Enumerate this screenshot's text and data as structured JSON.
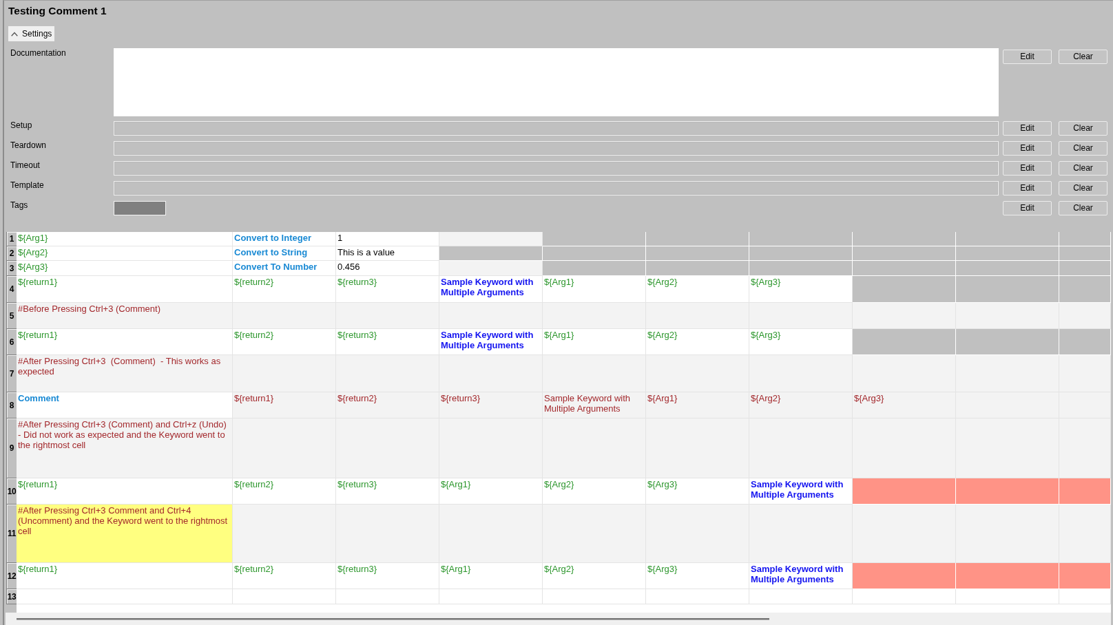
{
  "title": "Testing Comment 1",
  "settings_toggle": {
    "label": "Settings",
    "expanded": true
  },
  "settings": [
    {
      "label": "Documentation",
      "kind": "textarea",
      "buttons": [
        "Edit",
        "Clear"
      ]
    },
    {
      "label": "Setup",
      "kind": "line",
      "buttons": [
        "Edit",
        "Clear"
      ]
    },
    {
      "label": "Teardown",
      "kind": "line",
      "buttons": [
        "Edit",
        "Clear"
      ]
    },
    {
      "label": "Timeout",
      "kind": "line",
      "buttons": [
        "Edit",
        "Clear"
      ]
    },
    {
      "label": "Template",
      "kind": "line",
      "buttons": [
        "Edit",
        "Clear"
      ]
    },
    {
      "label": "Tags",
      "kind": "tags",
      "buttons": [
        "Edit",
        "Clear"
      ]
    }
  ],
  "grid": {
    "rows": [
      {
        "number": "1",
        "cells": [
          {
            "text": "${Arg1}",
            "kind": "variable",
            "color": "#ffffff"
          },
          {
            "text": "Convert to Integer",
            "kind": "library_keyword",
            "color": "#ffffff"
          },
          {
            "text": "1",
            "kind": "value",
            "color": "#ffffff"
          },
          {
            "color": "#f3f3f3"
          },
          {
            "color": "#c0c0c0"
          },
          {
            "color": "#c0c0c0"
          },
          {
            "color": "#c0c0c0"
          },
          {
            "color": "#c0c0c0"
          },
          {
            "color": "#c0c0c0"
          },
          {
            "color": "#c0c0c0"
          }
        ]
      },
      {
        "number": "2",
        "cells": [
          {
            "text": "${Arg2}",
            "kind": "variable",
            "color": "#ffffff"
          },
          {
            "text": "Convert to String",
            "kind": "library_keyword",
            "color": "#ffffff"
          },
          {
            "text": "This is a value",
            "kind": "value",
            "color": "#ffffff"
          },
          {
            "color": "#c0c0c0"
          },
          {
            "color": "#c0c0c0"
          },
          {
            "color": "#c0c0c0"
          },
          {
            "color": "#c0c0c0"
          },
          {
            "color": "#c0c0c0"
          },
          {
            "color": "#c0c0c0"
          },
          {
            "color": "#c0c0c0"
          }
        ]
      },
      {
        "number": "3",
        "cells": [
          {
            "text": "${Arg3}",
            "kind": "variable",
            "color": "#ffffff"
          },
          {
            "text": "Convert To Number",
            "kind": "library_keyword",
            "color": "#ffffff"
          },
          {
            "text": "0.456",
            "kind": "value",
            "color": "#ffffff"
          },
          {
            "color": "#f3f3f3"
          },
          {
            "color": "#c0c0c0"
          },
          {
            "color": "#c0c0c0"
          },
          {
            "color": "#c0c0c0"
          },
          {
            "color": "#c0c0c0"
          },
          {
            "color": "#c0c0c0"
          },
          {
            "color": "#c0c0c0"
          }
        ]
      },
      {
        "number": "4",
        "cells": [
          {
            "text": "${return1}",
            "kind": "variable",
            "color": "#ffffff"
          },
          {
            "text": "${return2}",
            "kind": "variable",
            "color": "#ffffff"
          },
          {
            "text": "${return3}",
            "kind": "variable",
            "color": "#ffffff"
          },
          {
            "text": "Sample Keyword with Multiple Arguments",
            "kind": "user_keyword",
            "color": "#ffffff"
          },
          {
            "text": "${Arg1}",
            "kind": "variable",
            "color": "#ffffff"
          },
          {
            "text": "${Arg2}",
            "kind": "variable",
            "color": "#ffffff"
          },
          {
            "text": "${Arg3}",
            "kind": "variable",
            "color": "#ffffff"
          },
          {
            "color": "#c0c0c0"
          },
          {
            "color": "#c0c0c0"
          },
          {
            "color": "#c0c0c0"
          }
        ]
      },
      {
        "number": "5",
        "cells": [
          {
            "text": "#Before Pressing Ctrl+3 (Comment)",
            "kind": "comment",
            "color": "#f3f3f3"
          },
          {
            "color": "#f3f3f3"
          },
          {
            "color": "#f3f3f3"
          },
          {
            "color": "#f3f3f3"
          },
          {
            "color": "#f3f3f3"
          },
          {
            "color": "#f3f3f3"
          },
          {
            "color": "#f3f3f3"
          },
          {
            "color": "#f3f3f3"
          },
          {
            "color": "#f3f3f3"
          },
          {
            "color": "#f3f3f3"
          }
        ]
      },
      {
        "number": "6",
        "cells": [
          {
            "text": "${return1}",
            "kind": "variable",
            "color": "#ffffff"
          },
          {
            "text": "${return2}",
            "kind": "variable",
            "color": "#ffffff"
          },
          {
            "text": "${return3}",
            "kind": "variable",
            "color": "#ffffff"
          },
          {
            "text": "Sample Keyword with Multiple Arguments",
            "kind": "user_keyword",
            "color": "#ffffff"
          },
          {
            "text": "${Arg1}",
            "kind": "variable",
            "color": "#ffffff"
          },
          {
            "text": "${Arg2}",
            "kind": "variable",
            "color": "#ffffff"
          },
          {
            "text": "${Arg3}",
            "kind": "variable",
            "color": "#ffffff"
          },
          {
            "color": "#c0c0c0"
          },
          {
            "color": "#c0c0c0"
          },
          {
            "color": "#c0c0c0"
          }
        ]
      },
      {
        "number": "7",
        "cells": [
          {
            "text": "#After Pressing Ctrl+3  (Comment)  - This works as expected",
            "kind": "comment",
            "color": "#f3f3f3"
          },
          {
            "color": "#f3f3f3"
          },
          {
            "color": "#f3f3f3"
          },
          {
            "color": "#f3f3f3"
          },
          {
            "color": "#f3f3f3"
          },
          {
            "color": "#f3f3f3"
          },
          {
            "color": "#f3f3f3"
          },
          {
            "color": "#f3f3f3"
          },
          {
            "color": "#f3f3f3"
          },
          {
            "color": "#f3f3f3"
          }
        ]
      },
      {
        "number": "8",
        "cells": [
          {
            "text": "Comment",
            "kind": "library_keyword",
            "color": "#ffffff"
          },
          {
            "text": "${return1}",
            "kind": "comment",
            "color": "#f3f3f3"
          },
          {
            "text": "${return2}",
            "kind": "comment",
            "color": "#f3f3f3"
          },
          {
            "text": "${return3}",
            "kind": "comment",
            "color": "#f3f3f3"
          },
          {
            "text": "Sample Keyword with Multiple Arguments",
            "kind": "comment",
            "color": "#f3f3f3"
          },
          {
            "text": "${Arg1}",
            "kind": "comment",
            "color": "#f3f3f3"
          },
          {
            "text": "${Arg2}",
            "kind": "comment",
            "color": "#f3f3f3"
          },
          {
            "text": "${Arg3}",
            "kind": "comment",
            "color": "#f3f3f3"
          },
          {
            "color": "#f3f3f3"
          },
          {
            "color": "#f3f3f3"
          }
        ]
      },
      {
        "number": "9",
        "cells": [
          {
            "text": "#After Pressing Ctrl+3 (Comment) and Ctrl+z (Undo) - Did not work as expected and the Keyword went to the rightmost cell",
            "kind": "comment",
            "color": "#f3f3f3"
          },
          {
            "color": "#f3f3f3"
          },
          {
            "color": "#f3f3f3"
          },
          {
            "color": "#f3f3f3"
          },
          {
            "color": "#f3f3f3"
          },
          {
            "color": "#f3f3f3"
          },
          {
            "color": "#f3f3f3"
          },
          {
            "color": "#f3f3f3"
          },
          {
            "color": "#f3f3f3"
          },
          {
            "color": "#f3f3f3"
          }
        ]
      },
      {
        "number": "10",
        "cells": [
          {
            "text": "${return1}",
            "kind": "variable",
            "color": "#ffffff"
          },
          {
            "text": "${return2}",
            "kind": "variable",
            "color": "#ffffff"
          },
          {
            "text": "${return3}",
            "kind": "variable",
            "color": "#ffffff"
          },
          {
            "text": "${Arg1}",
            "kind": "variable",
            "color": "#ffffff"
          },
          {
            "text": "${Arg2}",
            "kind": "variable",
            "color": "#ffffff"
          },
          {
            "text": "${Arg3}",
            "kind": "variable",
            "color": "#ffffff"
          },
          {
            "text": "Sample Keyword with Multiple Arguments",
            "kind": "user_keyword",
            "color": "#ffffff"
          },
          {
            "color": "#ff9386"
          },
          {
            "color": "#ff9386"
          },
          {
            "color": "#ff9386"
          }
        ]
      },
      {
        "number": "11",
        "cells": [
          {
            "text": "#After Pressing Ctrl+3 Comment and Ctrl+4 (Uncomment) and the Keyword went to the rightmost cell",
            "kind": "comment",
            "color": "#ffff80"
          },
          {
            "color": "#f3f3f3"
          },
          {
            "color": "#f3f3f3"
          },
          {
            "color": "#f3f3f3"
          },
          {
            "color": "#f3f3f3"
          },
          {
            "color": "#f3f3f3"
          },
          {
            "color": "#f3f3f3"
          },
          {
            "color": "#f3f3f3"
          },
          {
            "color": "#f3f3f3"
          },
          {
            "color": "#f3f3f3"
          }
        ]
      },
      {
        "number": "12",
        "cells": [
          {
            "text": "${return1}",
            "kind": "variable",
            "color": "#ffffff"
          },
          {
            "text": "${return2}",
            "kind": "variable",
            "color": "#ffffff"
          },
          {
            "text": "${return3}",
            "kind": "variable",
            "color": "#ffffff"
          },
          {
            "text": "${Arg1}",
            "kind": "variable",
            "color": "#ffffff"
          },
          {
            "text": "${Arg2}",
            "kind": "variable",
            "color": "#ffffff"
          },
          {
            "text": "${Arg3}",
            "kind": "variable",
            "color": "#ffffff"
          },
          {
            "text": "Sample Keyword with Multiple Arguments",
            "kind": "user_keyword",
            "color": "#ffffff"
          },
          {
            "color": "#ff9386"
          },
          {
            "color": "#ff9386"
          },
          {
            "color": "#ff9386"
          }
        ]
      },
      {
        "number": "13",
        "cells": [
          {
            "color": "#ffffff"
          },
          {
            "color": "#ffffff"
          },
          {
            "color": "#ffffff"
          },
          {
            "color": "#ffffff"
          },
          {
            "color": "#ffffff"
          },
          {
            "color": "#ffffff"
          },
          {
            "color": "#ffffff"
          },
          {
            "color": "#ffffff"
          },
          {
            "color": "#ffffff"
          },
          {
            "color": "#ffffff"
          }
        ]
      }
    ]
  }
}
